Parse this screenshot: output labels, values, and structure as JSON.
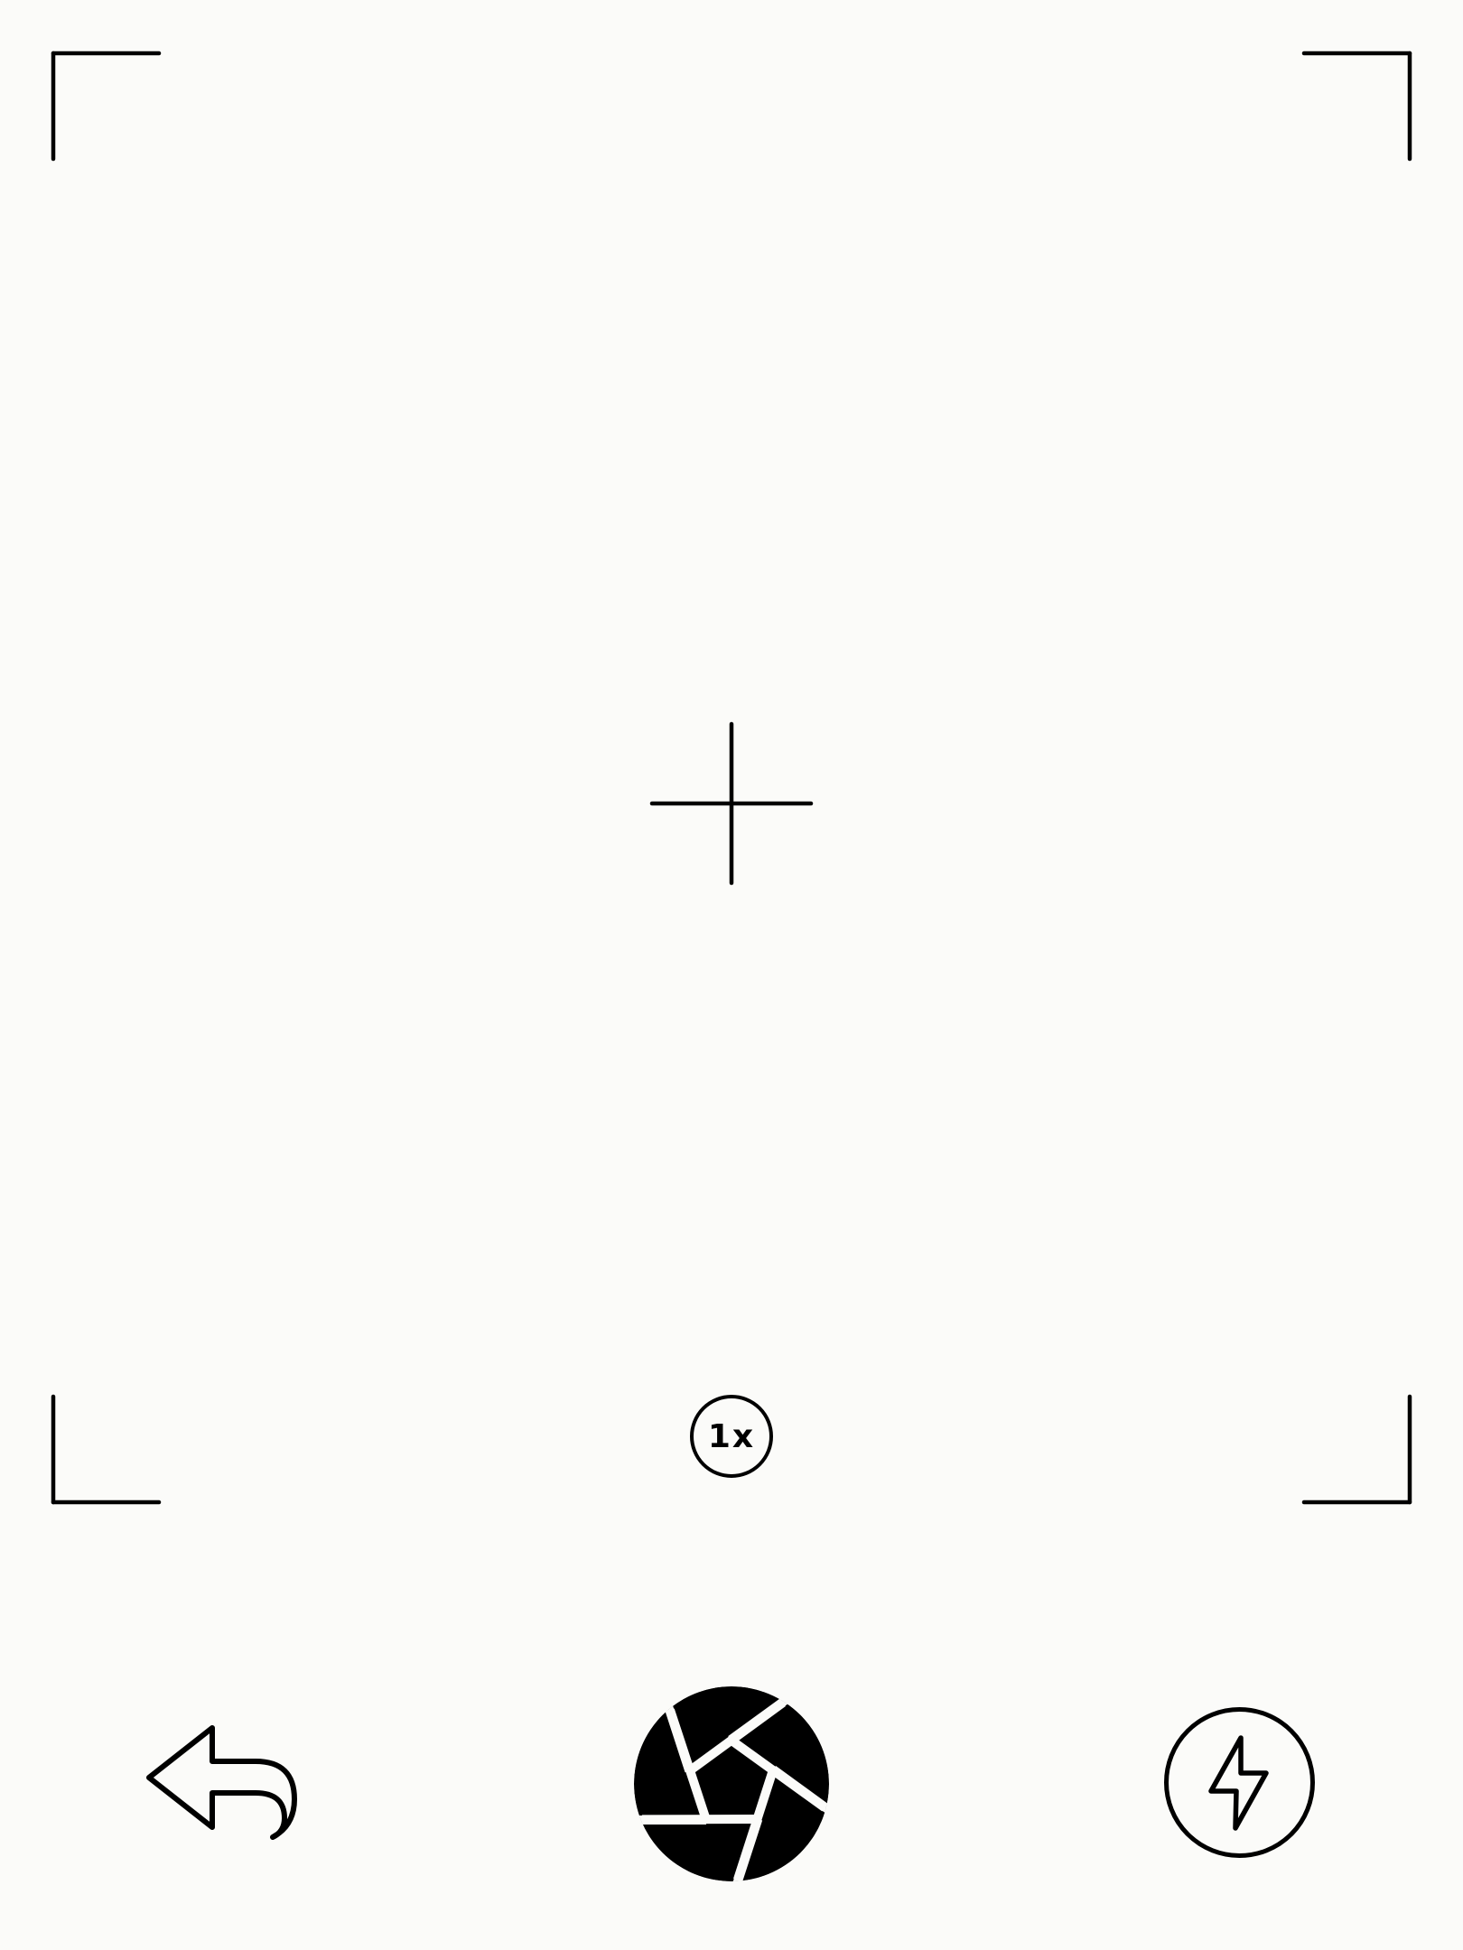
{
  "viewfinder": {
    "frame_color": "#000000",
    "background_color": "#fbfbf9",
    "center_marker_icon": "crosshair-icon"
  },
  "zoom": {
    "label": "1x"
  },
  "controls": {
    "back_icon": "undo-arrow-icon",
    "shutter_icon": "aperture-icon",
    "flash_icon": "lightning-bolt-icon"
  }
}
